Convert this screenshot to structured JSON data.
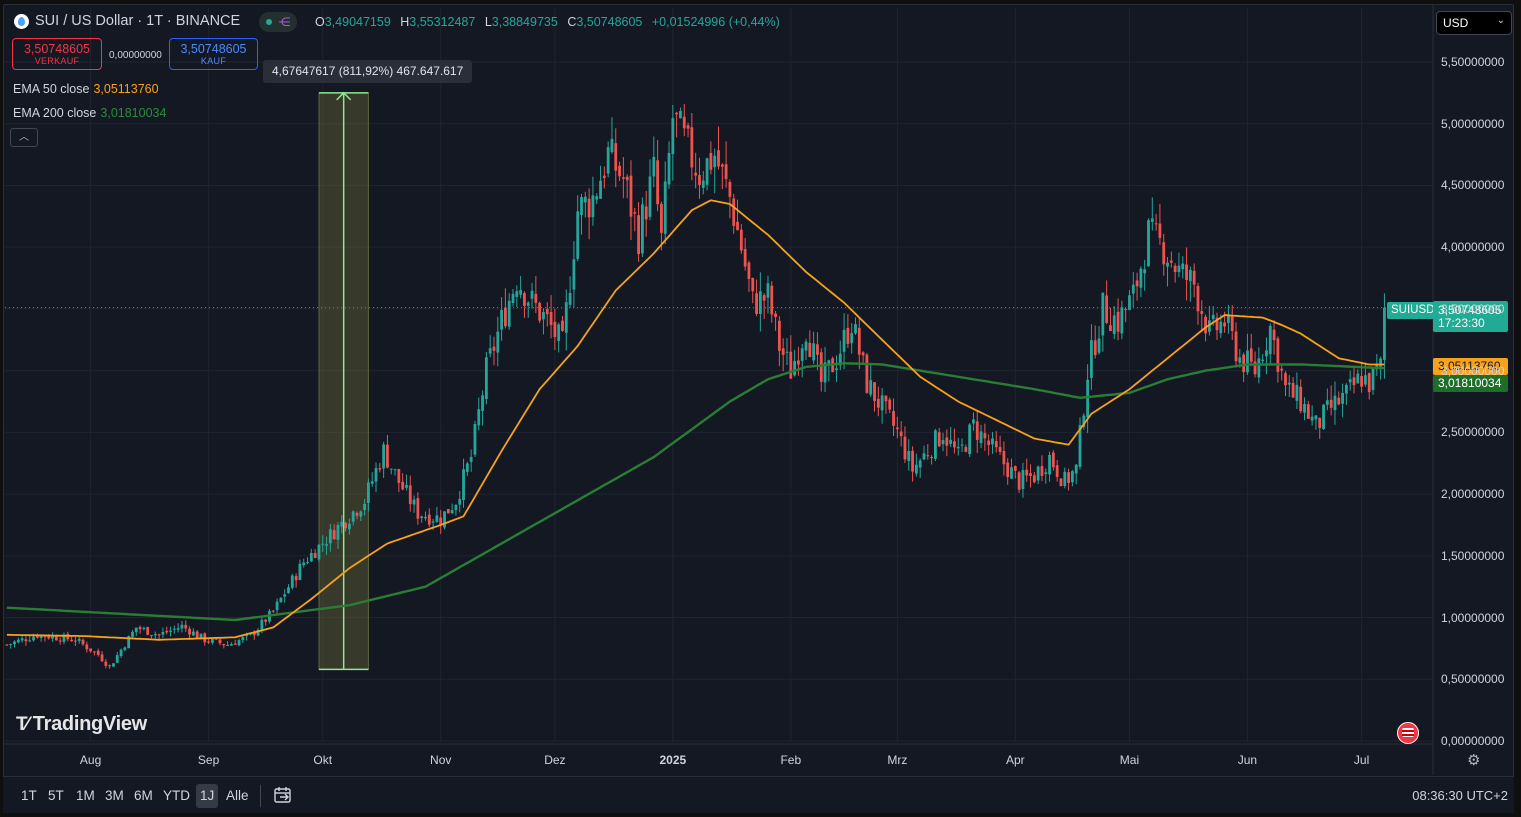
{
  "header": {
    "title": "SUI / US Dollar · 1T · BINANCE",
    "ohlc": [
      {
        "k": "O",
        "v": "3,49047159"
      },
      {
        "k": "H",
        "v": "3,55312487"
      },
      {
        "k": "L",
        "v": "3,38849735"
      },
      {
        "k": "C",
        "v": "3,50748605"
      }
    ],
    "change": "+0,01524996 (+0,44%)",
    "currency": "USD"
  },
  "trade": {
    "sell_price": "3,50748605",
    "sell_label": "VERKAUF",
    "spread": "0,00000000",
    "buy_price": "3,50748605",
    "buy_label": "KAUF"
  },
  "measure_label": "4,67647617 (811,92%) 467.647.617",
  "indicators": {
    "ema50_label": "EMA 50 close",
    "ema50_value": "3,05113760",
    "ema200_label": "EMA 200 close",
    "ema200_value": "3,01810034"
  },
  "price_tags": {
    "symbol": "SUIUSD",
    "last": "3,50748605",
    "countdown": "17:23:30",
    "ema50": "3,05113760",
    "ema200": "3,01810034"
  },
  "colors": {
    "up": "#26a69a",
    "down": "#ef5350",
    "ema50": "#f7a21b",
    "ema200": "#1e6e2a",
    "measure": "#8ee88e"
  },
  "logo": "TradingView",
  "ranges": [
    {
      "label": "1T",
      "active": false
    },
    {
      "label": "5T",
      "active": false
    },
    {
      "label": "1M",
      "active": false
    },
    {
      "label": "3M",
      "active": false
    },
    {
      "label": "6M",
      "active": false
    },
    {
      "label": "YTD",
      "active": false
    },
    {
      "label": "1J",
      "active": true
    },
    {
      "label": "Alle",
      "active": false
    }
  ],
  "clock": "08:36:30 UTC+2",
  "chart_data": {
    "type": "candlestick",
    "title": "SUI / US Dollar · 1T · BINANCE",
    "y_ticks": [
      "5,50000000",
      "5,00000000",
      "4,50000000",
      "4,00000000",
      "3,50000000",
      "3,00000000",
      "2,50000000",
      "2,00000000",
      "1,50000000",
      "1,00000000",
      "0,50000000",
      "0,00000000"
    ],
    "y_tick_values": [
      5.5,
      5.0,
      4.5,
      4.0,
      3.5,
      3.0,
      2.5,
      2.0,
      1.5,
      1.0,
      0.5,
      0.0
    ],
    "ylim": [
      0,
      5.5
    ],
    "x_ticks": [
      "Aug",
      "Sep",
      "Okt",
      "Nov",
      "Dez",
      "2025",
      "Feb",
      "Mrz",
      "Apr",
      "Mai",
      "Jun",
      "Jul"
    ],
    "x_tick_days": [
      22,
      53,
      83,
      114,
      144,
      175,
      206,
      234,
      265,
      295,
      326,
      356
    ],
    "n_days": 375,
    "price_path": [
      [
        0,
        0.78
      ],
      [
        8,
        0.86
      ],
      [
        18,
        0.82
      ],
      [
        24,
        0.7
      ],
      [
        27,
        0.6
      ],
      [
        30,
        0.74
      ],
      [
        34,
        0.92
      ],
      [
        40,
        0.86
      ],
      [
        46,
        0.93
      ],
      [
        52,
        0.82
      ],
      [
        58,
        0.78
      ],
      [
        64,
        0.85
      ],
      [
        70,
        1.05
      ],
      [
        78,
        1.45
      ],
      [
        86,
        1.7
      ],
      [
        94,
        1.95
      ],
      [
        99,
        2.35
      ],
      [
        103,
        2.1
      ],
      [
        108,
        1.85
      ],
      [
        114,
        1.8
      ],
      [
        118,
        1.95
      ],
      [
        122,
        2.3
      ],
      [
        126,
        3.0
      ],
      [
        130,
        3.4
      ],
      [
        134,
        3.75
      ],
      [
        138,
        3.55
      ],
      [
        142,
        3.4
      ],
      [
        146,
        3.2
      ],
      [
        150,
        4.3
      ],
      [
        154,
        4.4
      ],
      [
        158,
        4.75
      ],
      [
        162,
        4.55
      ],
      [
        166,
        4.1
      ],
      [
        170,
        4.6
      ],
      [
        172,
        4.05
      ],
      [
        175,
        5.05
      ],
      [
        178,
        4.85
      ],
      [
        182,
        4.6
      ],
      [
        186,
        4.75
      ],
      [
        190,
        4.4
      ],
      [
        193,
        4.0
      ],
      [
        196,
        3.55
      ],
      [
        200,
        3.6
      ],
      [
        203,
        3.2
      ],
      [
        206,
        3.0
      ],
      [
        210,
        3.35
      ],
      [
        214,
        2.9
      ],
      [
        218,
        3.1
      ],
      [
        222,
        3.4
      ],
      [
        226,
        2.9
      ],
      [
        230,
        2.7
      ],
      [
        234,
        2.5
      ],
      [
        238,
        2.2
      ],
      [
        242,
        2.35
      ],
      [
        246,
        2.5
      ],
      [
        250,
        2.3
      ],
      [
        254,
        2.55
      ],
      [
        258,
        2.4
      ],
      [
        262,
        2.25
      ],
      [
        266,
        2.1
      ],
      [
        270,
        2.15
      ],
      [
        274,
        2.3
      ],
      [
        278,
        2.1
      ],
      [
        281,
        2.2
      ],
      [
        284,
        3.0
      ],
      [
        288,
        3.5
      ],
      [
        292,
        3.4
      ],
      [
        296,
        3.6
      ],
      [
        300,
        4.1
      ],
      [
        304,
        4.0
      ],
      [
        308,
        3.8
      ],
      [
        312,
        3.7
      ],
      [
        316,
        3.3
      ],
      [
        320,
        3.4
      ],
      [
        324,
        3.1
      ],
      [
        328,
        3.0
      ],
      [
        332,
        3.35
      ],
      [
        336,
        2.85
      ],
      [
        340,
        2.75
      ],
      [
        344,
        2.55
      ],
      [
        348,
        2.7
      ],
      [
        352,
        2.8
      ],
      [
        356,
        2.95
      ],
      [
        358,
        2.9
      ],
      [
        361,
        3.03
      ],
      [
        362,
        3.51
      ]
    ],
    "ema50_path": [
      [
        0,
        0.86
      ],
      [
        20,
        0.85
      ],
      [
        40,
        0.82
      ],
      [
        60,
        0.84
      ],
      [
        70,
        0.92
      ],
      [
        80,
        1.15
      ],
      [
        90,
        1.4
      ],
      [
        100,
        1.6
      ],
      [
        114,
        1.75
      ],
      [
        120,
        1.82
      ],
      [
        130,
        2.35
      ],
      [
        140,
        2.85
      ],
      [
        150,
        3.2
      ],
      [
        160,
        3.65
      ],
      [
        170,
        3.95
      ],
      [
        180,
        4.3
      ],
      [
        185,
        4.38
      ],
      [
        190,
        4.35
      ],
      [
        200,
        4.1
      ],
      [
        210,
        3.8
      ],
      [
        220,
        3.55
      ],
      [
        230,
        3.25
      ],
      [
        240,
        2.95
      ],
      [
        250,
        2.75
      ],
      [
        260,
        2.6
      ],
      [
        270,
        2.45
      ],
      [
        279,
        2.4
      ],
      [
        285,
        2.65
      ],
      [
        295,
        2.85
      ],
      [
        305,
        3.1
      ],
      [
        315,
        3.35
      ],
      [
        320,
        3.45
      ],
      [
        330,
        3.43
      ],
      [
        335,
        3.37
      ],
      [
        340,
        3.3
      ],
      [
        350,
        3.1
      ],
      [
        358,
        3.05
      ],
      [
        362,
        3.05
      ]
    ],
    "ema200_path": [
      [
        0,
        1.08
      ],
      [
        30,
        1.03
      ],
      [
        60,
        0.98
      ],
      [
        90,
        1.1
      ],
      [
        110,
        1.25
      ],
      [
        130,
        1.6
      ],
      [
        150,
        1.95
      ],
      [
        170,
        2.3
      ],
      [
        190,
        2.75
      ],
      [
        200,
        2.93
      ],
      [
        210,
        3.03
      ],
      [
        220,
        3.06
      ],
      [
        230,
        3.05
      ],
      [
        250,
        2.95
      ],
      [
        270,
        2.85
      ],
      [
        282,
        2.78
      ],
      [
        295,
        2.82
      ],
      [
        305,
        2.93
      ],
      [
        315,
        3.0
      ],
      [
        326,
        3.05
      ],
      [
        340,
        3.05
      ],
      [
        362,
        3.02
      ]
    ],
    "measure": {
      "from_day": 82,
      "to_day": 95,
      "low": 0.58,
      "high": 5.25
    }
  }
}
